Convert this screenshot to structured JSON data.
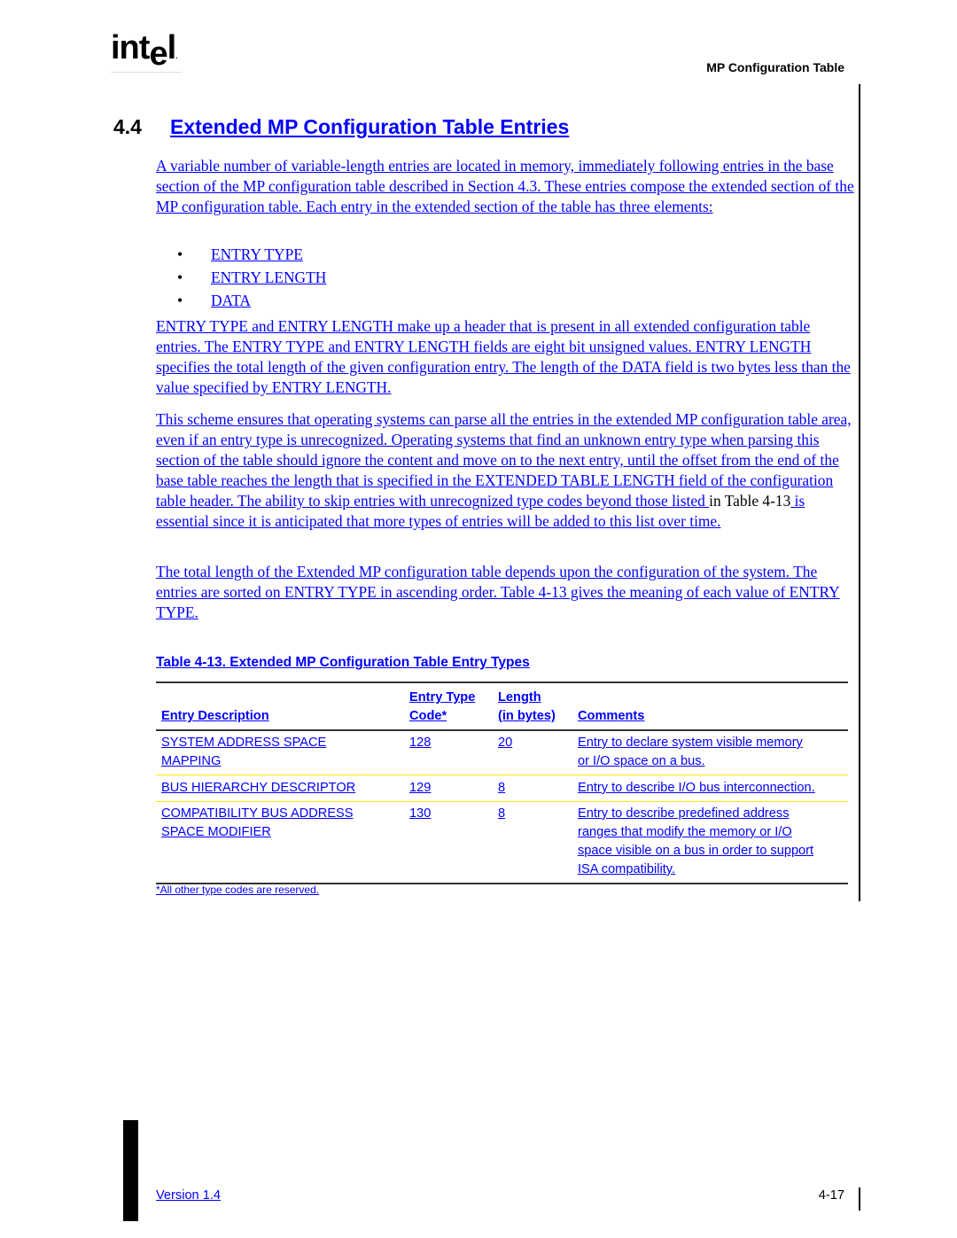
{
  "header": {
    "logo_text": "int",
    "logo_e": "e",
    "logo_l": "l",
    "logo_mark": ".",
    "running_head": "MP Configuration Table"
  },
  "section": {
    "number": "4.4",
    "title": "Extended MP Configuration Table Entries"
  },
  "paragraphs": {
    "p1": "A variable number of variable-length entries are located in memory, immediately following entries in the base section of the MP configuration table described in Section 4.3.  These entries compose the extended section of the MP configuration table. Each entry in the extended section of the table has three elements:",
    "bullets": [
      "ENTRY TYPE",
      "ENTRY LENGTH",
      "DATA"
    ],
    "bullet_glyph": "•",
    "p2": "ENTRY TYPE and ENTRY LENGTH make up a header that is present in all extended configuration table entries.  The ENTRY TYPE and ENTRY LENGTH fields are eight bit unsigned values.  ENTRY LENGTH specifies the total length of the given configuration entry. The length of the DATA field is two bytes less than the value specified by ENTRY LENGTH.",
    "p3_a": "This scheme ensures that operating systems can parse all the entries in the extended MP configuration table area, even if an entry type is unrecognized.  Operating systems that find an unknown entry type when parsing this section of the table should ignore the content and move on to the next entry, until the offset from the end of the base table reaches the length that is specified in the EXTENDED TABLE LENGTH field of the configuration table header.  The ability to skip entries with unrecognized type codes beyond those listed ",
    "p3_b": "in Table 4-13",
    "p3_c": " is essential since it is anticipated that more types of entries will be added to this list over time.",
    "p4_a": "The total length of the Extended MP configuration table depends upon the configuration of the system. The entries are sorted on ENTRY TYPE in ascending order. ",
    "p4_b": " Table 4-13 gives the meaning of each value of ENTRY TYPE."
  },
  "table": {
    "title": "Table 4-13.  Extended MP Configuration Table Entry Types",
    "headers": {
      "description": "Entry Description",
      "code_line1": "Entry Type",
      "code_line2": "Code*",
      "length_line1": "Length",
      "length_line2": "(in bytes)",
      "comments": "Comments"
    },
    "rows": [
      {
        "description": [
          "SYSTEM ADDRESS SPACE",
          "MAPPING"
        ],
        "code": "128",
        "length": "20",
        "comments": [
          "Entry to declare system visible memory",
          "or I/O space on a bus."
        ]
      },
      {
        "description": [
          "BUS HIERARCHY DESCRIPTOR"
        ],
        "code": "129",
        "length": "8",
        "comments": [
          "Entry to describe I/O bus interconnection."
        ]
      },
      {
        "description": [
          "COMPATIBILITY BUS ADDRESS",
          "SPACE MODIFIER"
        ],
        "code": "130",
        "length": "8",
        "comments": [
          "Entry to describe predefined address",
          "ranges that modify the memory or I/O",
          "space visible on a bus in order to support",
          "ISA compatibility."
        ]
      }
    ],
    "footnote": "*All other type codes are reserved."
  },
  "footer": {
    "version": "Version 1.4",
    "page_number": "4-17"
  },
  "colors": {
    "link": "#0000ff",
    "row_separator": "#ffe600",
    "text": "#000000"
  }
}
